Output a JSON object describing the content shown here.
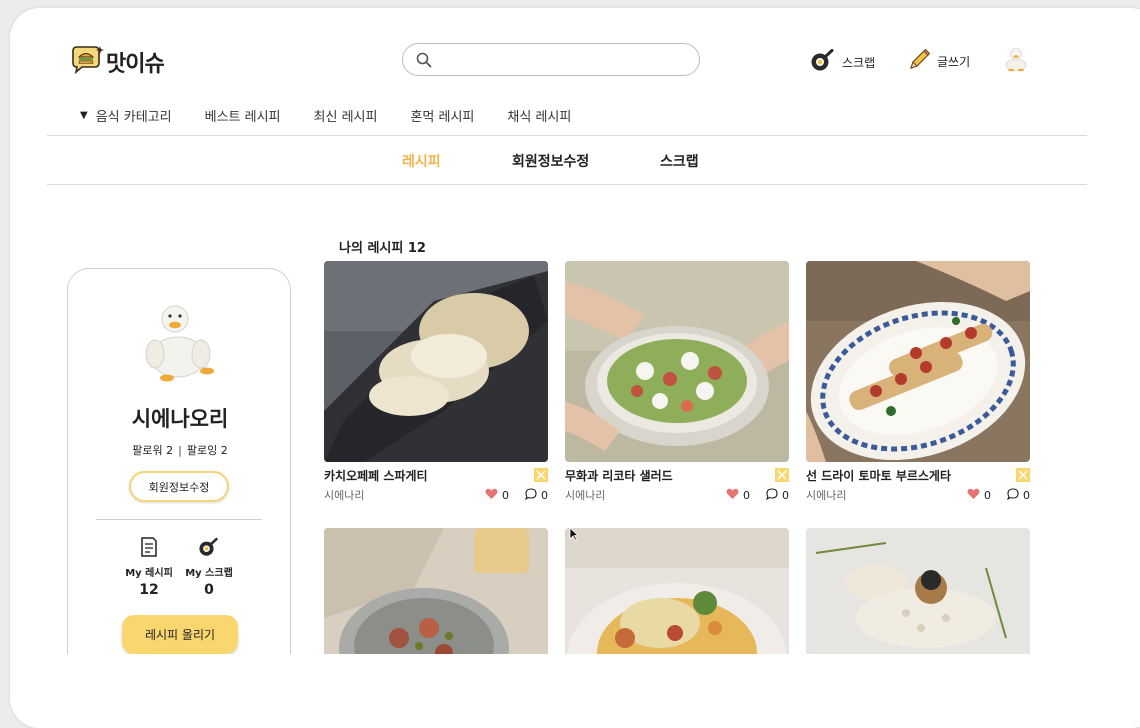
{
  "brand": {
    "name": "맛이슈"
  },
  "search": {
    "placeholder": ""
  },
  "header_actions": {
    "scrap": "스크랩",
    "write": "글쓰기"
  },
  "category_nav": [
    "음식 카테고리",
    "베스트 레시피",
    "최신 레시피",
    "혼먹 레시피",
    "채식 레시피"
  ],
  "tabs": [
    "레시피",
    "회원정보수정",
    "스크랩"
  ],
  "profile": {
    "name": "시에나오리",
    "followers": "팔로워 2",
    "following": "팔로잉 2",
    "edit_button": "회원정보수정",
    "my_recipe_label": "My 레시피",
    "my_recipe_count": "12",
    "my_scrap_label": "My 스크랩",
    "my_scrap_count": "0",
    "upload_button": "레시피 올리기"
  },
  "my_recipes_heading": "나의 레시피 12",
  "recipes": [
    {
      "title": "카치오페페 스파게티",
      "author": "시에나리",
      "likes": "0",
      "comments": "0"
    },
    {
      "title": "무화과 리코타 샐러드",
      "author": "시에나리",
      "likes": "0",
      "comments": "0"
    },
    {
      "title": "선 드라이 토마토 부르스게타",
      "author": "시에나리",
      "likes": "0",
      "comments": "0"
    },
    {
      "title": "",
      "author": "",
      "likes": "",
      "comments": ""
    },
    {
      "title": "",
      "author": "",
      "likes": "",
      "comments": ""
    },
    {
      "title": "",
      "author": "",
      "likes": "",
      "comments": ""
    }
  ],
  "colors": {
    "accent": "#f0b44c",
    "button_yellow": "#fad66f",
    "like_heart": "#e57373"
  },
  "icons": {
    "logo": "chat-bubble-burger-icon",
    "search": "search-icon",
    "scrap": "frying-pan-icon",
    "write": "pencil-icon",
    "avatar": "duck-avatar-icon",
    "recipe_book": "document-icon",
    "like": "heart-icon",
    "comment": "speech-bubble-icon",
    "tag": "cross-utensils-icon"
  }
}
